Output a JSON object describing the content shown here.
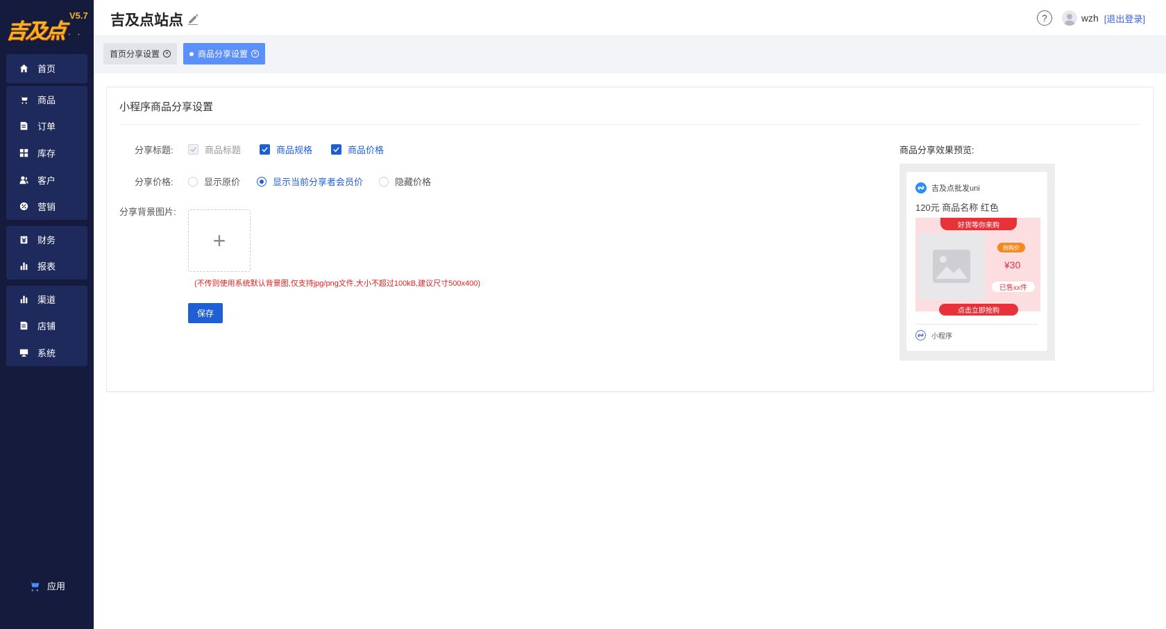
{
  "brand": {
    "logo_text": "吉及点",
    "version": "V5.7"
  },
  "sidebar": {
    "groups": [
      [
        {
          "label": "首页",
          "icon": "home-icon"
        }
      ],
      [
        {
          "label": "商品",
          "icon": "cart-icon"
        },
        {
          "label": "订单",
          "icon": "order-icon"
        },
        {
          "label": "库存",
          "icon": "grid-icon"
        },
        {
          "label": "客户",
          "icon": "user-icon"
        },
        {
          "label": "营销",
          "icon": "percent-icon"
        }
      ],
      [
        {
          "label": "财务",
          "icon": "finance-icon"
        },
        {
          "label": "报表",
          "icon": "bar-chart-icon"
        }
      ],
      [
        {
          "label": "渠道",
          "icon": "bar-chart-icon"
        },
        {
          "label": "店铺",
          "icon": "store-icon"
        },
        {
          "label": "系统",
          "icon": "monitor-icon"
        }
      ]
    ],
    "bottom_label": "应用"
  },
  "header": {
    "title": "吉及点站点",
    "help": "?",
    "username": "wzh",
    "logout": "[退出登录]"
  },
  "tabs": [
    {
      "label": "首页分享设置",
      "active": false
    },
    {
      "label": "商品分享设置",
      "active": true
    }
  ],
  "form": {
    "card_title": "小程序商品分享设置",
    "share_title_label": "分享标题:",
    "share_title_options": [
      {
        "label": "商品标题",
        "checked": true,
        "disabled": true
      },
      {
        "label": "商品规格",
        "checked": true,
        "disabled": false
      },
      {
        "label": "商品价格",
        "checked": true,
        "disabled": false
      }
    ],
    "share_price_label": "分享价格:",
    "share_price_options": [
      {
        "label": "显示原价",
        "selected": false
      },
      {
        "label": "显示当前分享者会员价",
        "selected": true
      },
      {
        "label": "隐藏价格",
        "selected": false
      }
    ],
    "bg_label": "分享背景图片:",
    "upload_plus": "+",
    "upload_hint": "(不传则使用系统默认背景图,仅支持jpg/png文件,大小不超过100kB,建议尺寸500x400)",
    "save_label": "保存"
  },
  "preview": {
    "title": "商品分享效果预览:",
    "app_name": "吉及点批发uni",
    "product_name": "120元 商品名称 红色",
    "ribbon": "好货等你来购",
    "tag": "抢购价",
    "price": "¥30",
    "sold": "已售xx件",
    "buy": "点击立即抢购",
    "footer": "小程序"
  },
  "colors": {
    "sidebar_bg": "#141b3c",
    "nav_group_bg": "#1e2a5c",
    "primary": "#1f5fd6",
    "active_tab": "#5b8ff9",
    "logo_gold": "#f6b327",
    "hint_red": "#e02020"
  }
}
